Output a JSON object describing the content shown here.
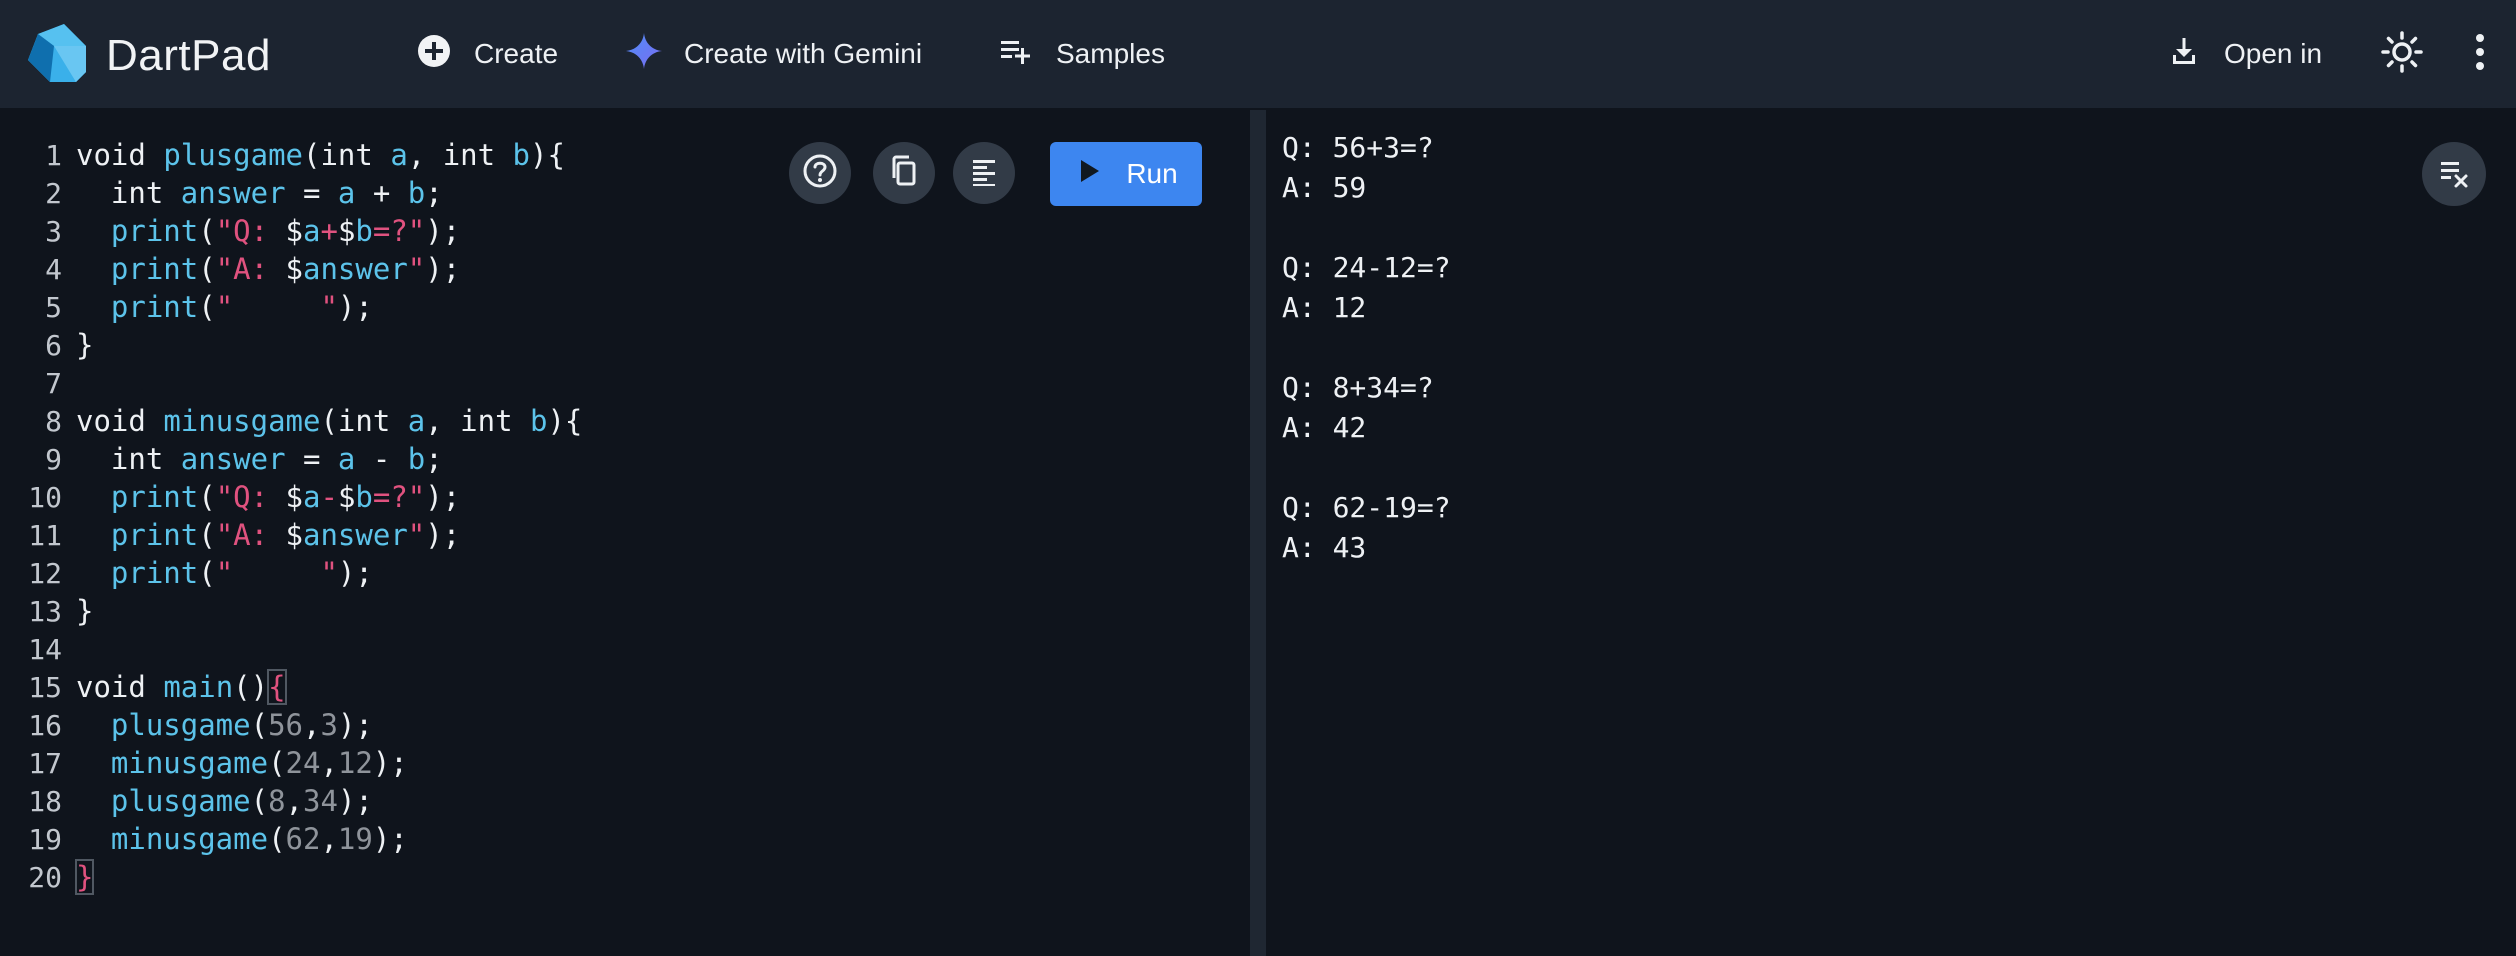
{
  "header": {
    "app_name": "DartPad",
    "create_label": "Create",
    "gemini_label": "Create with Gemini",
    "samples_label": "Samples",
    "open_in_label": "Open in"
  },
  "icons": {
    "logo": "dart-logo-icon",
    "create": "add-circle-icon",
    "gemini": "gemini-sparkle-icon",
    "samples": "playlist-add-icon",
    "open_in": "download-icon",
    "theme": "sun-icon",
    "more": "more-vert-icon",
    "help": "help-icon",
    "copy": "copy-icon",
    "format": "format-align-icon",
    "run": "play-icon",
    "clear": "clear-console-icon"
  },
  "editor": {
    "run_label": "Run",
    "lines": [
      {
        "n": "1",
        "tokens": [
          {
            "t": "void ",
            "c": ""
          },
          {
            "t": "plusgame",
            "c": "t-fn"
          },
          {
            "t": "(int ",
            "c": ""
          },
          {
            "t": "a",
            "c": "t-var"
          },
          {
            "t": ", int ",
            "c": ""
          },
          {
            "t": "b",
            "c": "t-var"
          },
          {
            "t": "){",
            "c": ""
          }
        ]
      },
      {
        "n": "2",
        "tokens": [
          {
            "t": "  int ",
            "c": ""
          },
          {
            "t": "answer",
            "c": "t-var"
          },
          {
            "t": " = ",
            "c": ""
          },
          {
            "t": "a",
            "c": "t-var"
          },
          {
            "t": " + ",
            "c": ""
          },
          {
            "t": "b",
            "c": "t-var"
          },
          {
            "t": ";",
            "c": ""
          }
        ]
      },
      {
        "n": "3",
        "tokens": [
          {
            "t": "  ",
            "c": ""
          },
          {
            "t": "print",
            "c": "t-fn"
          },
          {
            "t": "(",
            "c": ""
          },
          {
            "t": "\"Q: ",
            "c": "t-str"
          },
          {
            "t": "$",
            "c": ""
          },
          {
            "t": "a",
            "c": "t-var"
          },
          {
            "t": "+",
            "c": "t-str"
          },
          {
            "t": "$",
            "c": ""
          },
          {
            "t": "b",
            "c": "t-var"
          },
          {
            "t": "=?\"",
            "c": "t-str"
          },
          {
            "t": ");",
            "c": ""
          }
        ]
      },
      {
        "n": "4",
        "tokens": [
          {
            "t": "  ",
            "c": ""
          },
          {
            "t": "print",
            "c": "t-fn"
          },
          {
            "t": "(",
            "c": ""
          },
          {
            "t": "\"A: ",
            "c": "t-str"
          },
          {
            "t": "$",
            "c": ""
          },
          {
            "t": "answer",
            "c": "t-var"
          },
          {
            "t": "\"",
            "c": "t-str"
          },
          {
            "t": ");",
            "c": ""
          }
        ]
      },
      {
        "n": "5",
        "tokens": [
          {
            "t": "  ",
            "c": ""
          },
          {
            "t": "print",
            "c": "t-fn"
          },
          {
            "t": "(",
            "c": ""
          },
          {
            "t": "\"     \"",
            "c": "t-str"
          },
          {
            "t": ");",
            "c": ""
          }
        ]
      },
      {
        "n": "6",
        "tokens": [
          {
            "t": "}",
            "c": ""
          }
        ]
      },
      {
        "n": "7",
        "tokens": []
      },
      {
        "n": "8",
        "tokens": [
          {
            "t": "void ",
            "c": ""
          },
          {
            "t": "minusgame",
            "c": "t-fn"
          },
          {
            "t": "(int ",
            "c": ""
          },
          {
            "t": "a",
            "c": "t-var"
          },
          {
            "t": ", int ",
            "c": ""
          },
          {
            "t": "b",
            "c": "t-var"
          },
          {
            "t": "){",
            "c": ""
          }
        ]
      },
      {
        "n": "9",
        "tokens": [
          {
            "t": "  int ",
            "c": ""
          },
          {
            "t": "answer",
            "c": "t-var"
          },
          {
            "t": " = ",
            "c": ""
          },
          {
            "t": "a",
            "c": "t-var"
          },
          {
            "t": " - ",
            "c": ""
          },
          {
            "t": "b",
            "c": "t-var"
          },
          {
            "t": ";",
            "c": ""
          }
        ]
      },
      {
        "n": "10",
        "tokens": [
          {
            "t": "  ",
            "c": ""
          },
          {
            "t": "print",
            "c": "t-fn"
          },
          {
            "t": "(",
            "c": ""
          },
          {
            "t": "\"Q: ",
            "c": "t-str"
          },
          {
            "t": "$",
            "c": ""
          },
          {
            "t": "a",
            "c": "t-var"
          },
          {
            "t": "-",
            "c": "t-str"
          },
          {
            "t": "$",
            "c": ""
          },
          {
            "t": "b",
            "c": "t-var"
          },
          {
            "t": "=?\"",
            "c": "t-str"
          },
          {
            "t": ");",
            "c": ""
          }
        ]
      },
      {
        "n": "11",
        "tokens": [
          {
            "t": "  ",
            "c": ""
          },
          {
            "t": "print",
            "c": "t-fn"
          },
          {
            "t": "(",
            "c": ""
          },
          {
            "t": "\"A: ",
            "c": "t-str"
          },
          {
            "t": "$",
            "c": ""
          },
          {
            "t": "answer",
            "c": "t-var"
          },
          {
            "t": "\"",
            "c": "t-str"
          },
          {
            "t": ");",
            "c": ""
          }
        ]
      },
      {
        "n": "12",
        "tokens": [
          {
            "t": "  ",
            "c": ""
          },
          {
            "t": "print",
            "c": "t-fn"
          },
          {
            "t": "(",
            "c": ""
          },
          {
            "t": "\"     \"",
            "c": "t-str"
          },
          {
            "t": ");",
            "c": ""
          }
        ]
      },
      {
        "n": "13",
        "tokens": [
          {
            "t": "}",
            "c": ""
          }
        ]
      },
      {
        "n": "14",
        "tokens": []
      },
      {
        "n": "15",
        "tokens": [
          {
            "t": "void ",
            "c": ""
          },
          {
            "t": "main",
            "c": "t-fn"
          },
          {
            "t": "()",
            "c": ""
          },
          {
            "t": "{",
            "c": "t-brace"
          }
        ]
      },
      {
        "n": "16",
        "tokens": [
          {
            "t": "  ",
            "c": ""
          },
          {
            "t": "plusgame",
            "c": "t-fn"
          },
          {
            "t": "(",
            "c": ""
          },
          {
            "t": "56",
            "c": "t-num"
          },
          {
            "t": ",",
            "c": ""
          },
          {
            "t": "3",
            "c": "t-num"
          },
          {
            "t": ");",
            "c": ""
          }
        ]
      },
      {
        "n": "17",
        "tokens": [
          {
            "t": "  ",
            "c": ""
          },
          {
            "t": "minusgame",
            "c": "t-fn"
          },
          {
            "t": "(",
            "c": ""
          },
          {
            "t": "24",
            "c": "t-num"
          },
          {
            "t": ",",
            "c": ""
          },
          {
            "t": "12",
            "c": "t-num"
          },
          {
            "t": ");",
            "c": ""
          }
        ]
      },
      {
        "n": "18",
        "tokens": [
          {
            "t": "  ",
            "c": ""
          },
          {
            "t": "plusgame",
            "c": "t-fn"
          },
          {
            "t": "(",
            "c": ""
          },
          {
            "t": "8",
            "c": "t-num"
          },
          {
            "t": ",",
            "c": ""
          },
          {
            "t": "34",
            "c": "t-num"
          },
          {
            "t": ");",
            "c": ""
          }
        ]
      },
      {
        "n": "19",
        "tokens": [
          {
            "t": "  ",
            "c": ""
          },
          {
            "t": "minusgame",
            "c": "t-fn"
          },
          {
            "t": "(",
            "c": ""
          },
          {
            "t": "62",
            "c": "t-num"
          },
          {
            "t": ",",
            "c": ""
          },
          {
            "t": "19",
            "c": "t-num"
          },
          {
            "t": ");",
            "c": ""
          }
        ]
      },
      {
        "n": "20",
        "tokens": [
          {
            "t": "}",
            "c": "t-brace"
          }
        ]
      }
    ]
  },
  "console": {
    "lines": [
      "Q: 56+3=?",
      "A: 59",
      "",
      "Q: 24-12=?",
      "A: 12",
      "",
      "Q: 8+34=?",
      "A: 42",
      "",
      "Q: 62-19=?",
      "A: 43"
    ]
  },
  "colors": {
    "header_bg": "#1c2430",
    "editor_bg": "#0f141c",
    "run_button": "#3d86f0",
    "function_token": "#5cc3ea",
    "string_token": "#e0527f",
    "number_token": "#8f949b"
  }
}
